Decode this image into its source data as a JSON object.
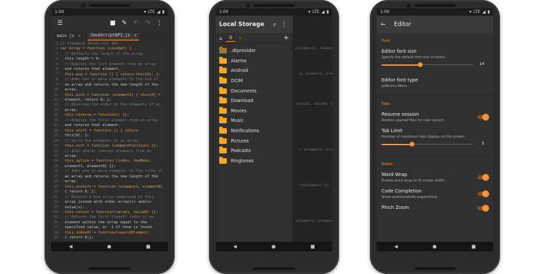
{
  "status": {
    "time": "1:00",
    "network": "LTE"
  },
  "nav": {
    "back": "◀",
    "home": "●",
    "recents": "■"
  },
  "editor": {
    "tabs": [
      {
        "label": "main.js",
        "close": "✕"
      },
      {
        "label": "JavaScriptAPI.js",
        "close": "✕"
      }
    ],
    "lines": [
      "// Standard JavaScript API",
      "var Array = function (sizeOpt) {",
      "  // Reflects the length of the array.",
      "  this.length = 0;",
      "  // Removes the last element from an array",
      "  and returns that element.",
      "  this.pop = function () { return this[0]; };",
      "  // Adds one or more elements to the end of",
      "  an array and returns the new length of the",
      "  array.",
      "  this.push = function (element1) { this[0] =",
      "  element; return 0; };",
      "  // Reverses the order of the elements of an",
      "  array.",
      "  this.reverse = function() {};",
      "  // Removes the first element from an array",
      "  and returns that element.",
      "  this.shift = function () { return",
      "  this[0]; };",
      "  // Sorts the elements of an array.",
      "  this.sort = function (compareFunction) {};",
      "  // Adds and/or removes elements from an",
      "  array.",
      "  this.splice = function (index, howMany,",
      "  element1, elementN) {};",
      "  // Adds one or more elements to the front of",
      "  an array and returns the new length of the",
      "  array.",
      "  this.unshift = function (element1, elementN)",
      "  { return 0; };",
      "  // Returns a new array comprised of this",
      "  array joined with other array(s) and/or",
      "  value(s).",
      "  this.concat = function(value1, valueN) {};",
      "  // Returns the first (least) index of an",
      "  element within the array equal to the",
      "  specified value, or -1 if none is found.",
      "  this.indexOf = function(searchElement)",
      "  { return 0;};"
    ]
  },
  "files": {
    "title": "Local Storage",
    "crumb": "0",
    "items": [
      {
        "name": ".dtprovider",
        "hidden": true
      },
      {
        "name": "Alarms"
      },
      {
        "name": "Android"
      },
      {
        "name": "DCIM"
      },
      {
        "name": "Documents"
      },
      {
        "name": "Download"
      },
      {
        "name": "Movies"
      },
      {
        "name": "Music"
      },
      {
        "name": "Notifications"
      },
      {
        "name": "Pictures"
      },
      {
        "name": "Podcasts"
      },
      {
        "name": "Ringtones"
      }
    ],
    "bg_code": "e(element1, elementN)\n\n\n\n\n  a, element1, elementN)\n\n\n\n\n\n(value1, valueN) {};\n\n\n\n\n\n\n\n\n  n (element1, elementN)\n\n\n\n\n\n\n  rchElement) {};\n\n\n\n\n\n\n(element1, elementN)"
  },
  "settings": {
    "title": "Editor",
    "sections": {
      "font": "Font",
      "tabs": "Tabs",
      "editor": "Editor"
    },
    "font_size": {
      "title": "Editor font size",
      "subtitle": "Specify the default font size of editor.",
      "value": "14",
      "fraction": 0.42
    },
    "font_type": {
      "title": "Editor font type",
      "subtitle": "JetBrains Mono"
    },
    "resume": {
      "title": "Resume session",
      "subtitle": "Restore opened files for next launch.",
      "on": true
    },
    "tab_limit": {
      "title": "Tab Limit",
      "subtitle": "Number of maximum tabs display on the screen.",
      "value": "5",
      "fraction": 0.33
    },
    "word_wrap": {
      "title": "Word Wrap",
      "subtitle": "Enable word wrap to fit screen width.",
      "on": true
    },
    "code_completion": {
      "title": "Code Completion",
      "subtitle": "Show autocomplete suggestions.",
      "on": true
    },
    "pinch_zoom": {
      "title": "Pinch Zoom",
      "on": true
    }
  },
  "colors": {
    "accent": "#f3953a",
    "folder": "#f4a92a",
    "surface": "#303030"
  }
}
